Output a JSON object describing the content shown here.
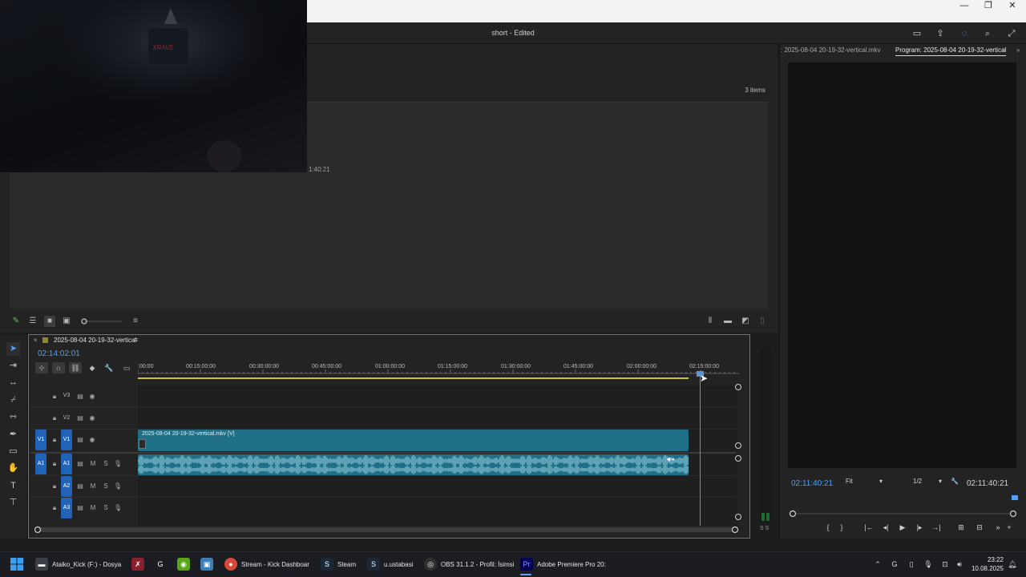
{
  "window": {
    "title": "short - Edited",
    "controls": {
      "minimize": "—",
      "maximize": "❐",
      "close": "✕"
    }
  },
  "header_icons": [
    "panel-icon",
    "share-icon",
    "sync-icon",
    "search-icon",
    "fullscreen-icon"
  ],
  "project_panel": {
    "item_count": "3 items",
    "time_label": "1:40:21"
  },
  "program_monitor": {
    "source_tab": ": 2025-08-04 20-19-32-vertical.mkv",
    "program_tab": "Program: 2025-08-04 20-19-32-vertical",
    "timecode_current": "02:11:40:21",
    "timecode_duration": "02:11:40:21",
    "fit": "Fit",
    "resolution": "1/2",
    "buttons": [
      "{",
      "}",
      "|←",
      "◂|",
      "▶",
      "|▸",
      "→|",
      "⊞",
      "⊟",
      "»",
      "+"
    ]
  },
  "timeline": {
    "sequence_name": "2025-08-04 20-19-32-vertical",
    "close": "×",
    "timecode": "02:14:02:01",
    "ruler_labels": [
      ":00:00",
      "00:15:00:00",
      "00:30:00:00",
      "00:45:00:00",
      "01:00:00:00",
      "01:15:00:00",
      "01:30:00:00",
      "01:45:00:00",
      "02:00:00:00",
      "02:15:00:00"
    ],
    "tracks": {
      "v3": "V3",
      "v2": "V2",
      "v1": "V1",
      "v1_src": "V1",
      "a1": "A1",
      "a1_src": "A1",
      "a2": "A2",
      "a3": "A3",
      "mute": "M",
      "solo": "S"
    },
    "video_clip": "2025-08-04 20-19-32-vertical.mkv [V]",
    "meter_label": "S S"
  },
  "taskbar": {
    "items": [
      {
        "label": "Ataiko_Kick (F:) - Dosya",
        "icon": "folder-icon"
      },
      {
        "label": "",
        "icon": "app-icon"
      },
      {
        "label": "",
        "icon": "app-icon"
      },
      {
        "label": "",
        "icon": "nvidia-icon"
      },
      {
        "label": "",
        "icon": "app-icon"
      },
      {
        "label": "Stream - Kick Dashboar",
        "icon": "chrome-icon"
      },
      {
        "label": "Steam",
        "icon": "steam-icon"
      },
      {
        "label": "u.ustabasi",
        "icon": "steam-icon"
      },
      {
        "label": "OBS 31.1.2 - Profil: İsimsi",
        "icon": "obs-icon"
      },
      {
        "label": "Adobe Premiere Pro 20:",
        "icon": "premiere-icon"
      }
    ],
    "clock_time": "23:22",
    "clock_date": "10.08.2025"
  }
}
